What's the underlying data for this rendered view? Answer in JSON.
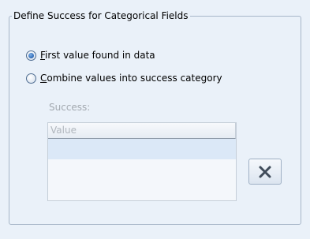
{
  "group": {
    "title": "Define Success for Categorical Fields"
  },
  "options": {
    "first_value": {
      "mnemonic": "F",
      "rest": "irst value found in data",
      "selected": true
    },
    "combine_values": {
      "mnemonic": "C",
      "rest": "ombine values into success category",
      "selected": false
    }
  },
  "success": {
    "label": "Success:",
    "column_header": "Value",
    "rows": [
      ""
    ]
  },
  "delete_button": {
    "icon": "delete-x-icon"
  },
  "colors": {
    "background": "#eaf1f9",
    "disabled_text": "#a3a9b0",
    "list_selection": "#dbe8f7",
    "radio_selected": "#2c66b1"
  }
}
